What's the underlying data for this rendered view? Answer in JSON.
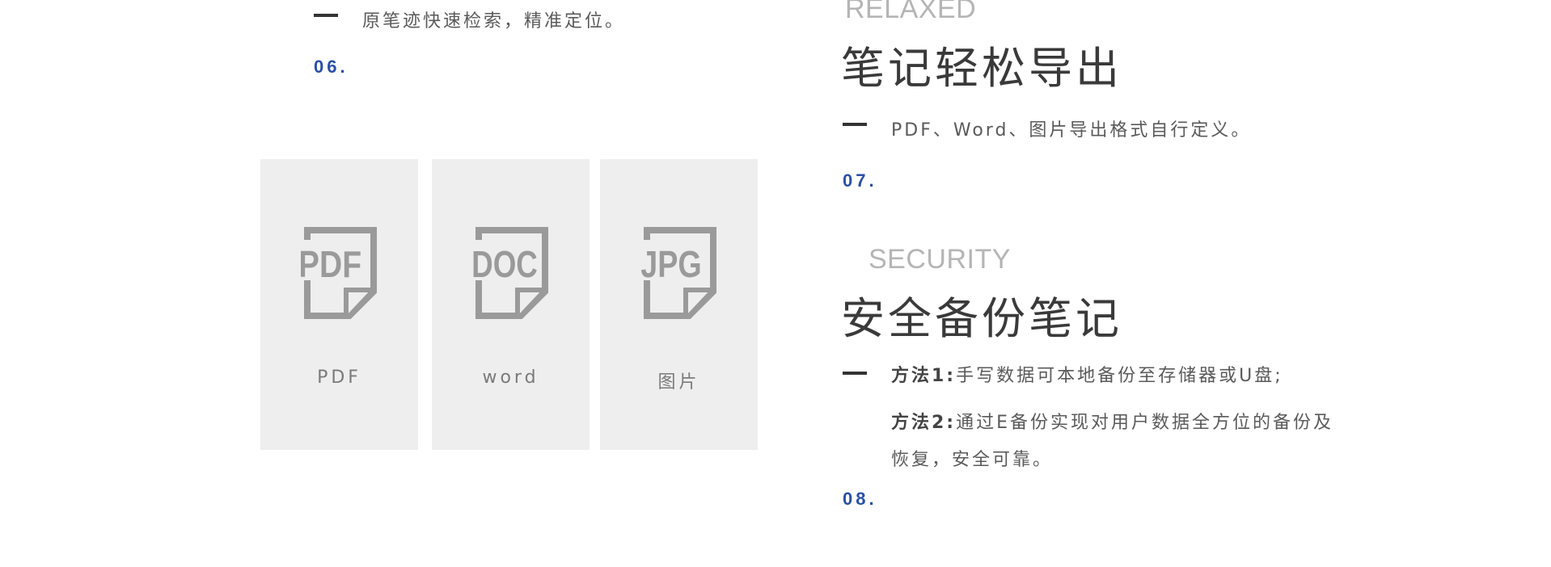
{
  "left": {
    "top_item": {
      "desc": "原笔迹快速检索，精准定位。",
      "number": "06."
    },
    "cards": [
      {
        "icon": "pdf-file-icon",
        "icon_text": "PDF",
        "label": "PDF"
      },
      {
        "icon": "doc-file-icon",
        "icon_text": "DOC",
        "label": "word"
      },
      {
        "icon": "jpg-file-icon",
        "icon_text": "JPG",
        "label": "图片"
      }
    ]
  },
  "right": {
    "export": {
      "en": "RELAXED",
      "title": "笔记轻松导出",
      "desc": "PDF、Word、图片导出格式自行定义。",
      "number": "07."
    },
    "security": {
      "en": "SECURITY",
      "title": "安全备份笔记",
      "method1_label": "方法1:",
      "method1_text": "手写数据可本地备份至存储器或U盘;",
      "method2_label": "方法2:",
      "method2_text_line1": "通过E备份实现对用户数据全方位的备份及",
      "method2_text_line2": "恢复，安全可靠。",
      "number": "08."
    }
  },
  "colors": {
    "accent_number": "#2a4fa8",
    "card_bg": "#eeeeee",
    "icon_gray": "#9a9a9a",
    "en_gray": "#b5b5b5"
  }
}
